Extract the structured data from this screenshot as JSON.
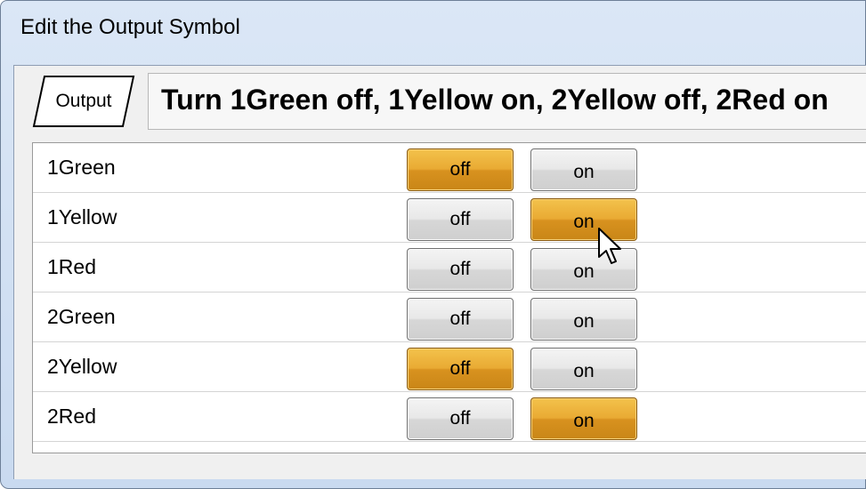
{
  "window": {
    "title": "Edit the Output Symbol"
  },
  "header": {
    "symbol_label": "Output",
    "summary": "Turn 1Green off, 1Yellow on, 2Yellow off, 2Red on"
  },
  "lights": [
    {
      "name": "1Green",
      "off_label": "off",
      "on_label": "on",
      "state": "off"
    },
    {
      "name": "1Yellow",
      "off_label": "off",
      "on_label": "on",
      "state": "on"
    },
    {
      "name": "1Red",
      "off_label": "off",
      "on_label": "on",
      "state": "none"
    },
    {
      "name": "2Green",
      "off_label": "off",
      "on_label": "on",
      "state": "none"
    },
    {
      "name": "2Yellow",
      "off_label": "off",
      "on_label": "on",
      "state": "off"
    },
    {
      "name": "2Red",
      "off_label": "off",
      "on_label": "on",
      "state": "on"
    }
  ],
  "colors": {
    "active_button": "#e9aa33",
    "inactive_button": "#e8e8e8"
  },
  "icons": {
    "cursor": "mouse-pointer-icon",
    "symbol": "parallelogram-output-icon"
  }
}
